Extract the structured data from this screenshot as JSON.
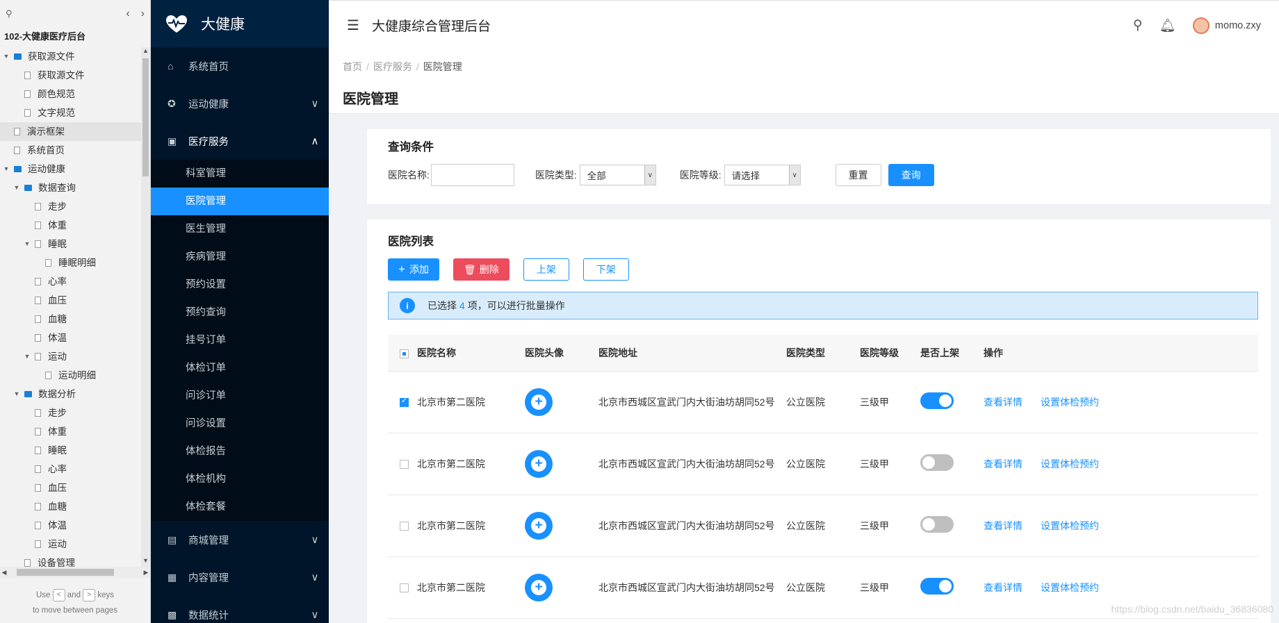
{
  "axure": {
    "project_title": "102-大健康医疗后台",
    "tree": [
      {
        "label": "获取源文件",
        "level": 0,
        "type": "folder",
        "twisty": "▼"
      },
      {
        "label": "获取源文件",
        "level": 1,
        "type": "page"
      },
      {
        "label": "颜色规范",
        "level": 1,
        "type": "page"
      },
      {
        "label": "文字规范",
        "level": 1,
        "type": "page"
      },
      {
        "label": "演示框架",
        "level": 0,
        "type": "page",
        "selected": true
      },
      {
        "label": "系统首页",
        "level": 0,
        "type": "page"
      },
      {
        "label": "运动健康",
        "level": 0,
        "type": "folder",
        "twisty": "▼"
      },
      {
        "label": "数据查询",
        "level": 1,
        "type": "folder",
        "twisty": "▼"
      },
      {
        "label": "走步",
        "level": 2,
        "type": "page"
      },
      {
        "label": "体重",
        "level": 2,
        "type": "page"
      },
      {
        "label": "睡眠",
        "level": 2,
        "type": "page",
        "twisty": "▼"
      },
      {
        "label": "睡眠明细",
        "level": 3,
        "type": "page"
      },
      {
        "label": "心率",
        "level": 2,
        "type": "page"
      },
      {
        "label": "血压",
        "level": 2,
        "type": "page"
      },
      {
        "label": "血糖",
        "level": 2,
        "type": "page"
      },
      {
        "label": "体温",
        "level": 2,
        "type": "page"
      },
      {
        "label": "运动",
        "level": 2,
        "type": "page",
        "twisty": "▼"
      },
      {
        "label": "运动明细",
        "level": 3,
        "type": "page"
      },
      {
        "label": "数据分析",
        "level": 1,
        "type": "folder",
        "twisty": "▼"
      },
      {
        "label": "走步",
        "level": 2,
        "type": "page"
      },
      {
        "label": "体重",
        "level": 2,
        "type": "page"
      },
      {
        "label": "睡眠",
        "level": 2,
        "type": "page"
      },
      {
        "label": "心率",
        "level": 2,
        "type": "page"
      },
      {
        "label": "血压",
        "level": 2,
        "type": "page"
      },
      {
        "label": "血糖",
        "level": 2,
        "type": "page"
      },
      {
        "label": "体温",
        "level": 2,
        "type": "page"
      },
      {
        "label": "运动",
        "level": 2,
        "type": "page"
      },
      {
        "label": "设备管理",
        "level": 1,
        "type": "page"
      }
    ],
    "hint": {
      "use": "Use",
      "and": "and",
      "keys": "keys",
      "line2": "to move between pages",
      "prev_key": "<",
      "next_key": ">"
    }
  },
  "app": {
    "logo_text": "大健康",
    "header_title": "大健康综合管理后台",
    "username": "momo.zxy"
  },
  "menu": {
    "home": "系统首页",
    "sports": "运动健康",
    "medical": "医疗服务",
    "medical_subs": [
      "科室管理",
      "医院管理",
      "医生管理",
      "疾病管理",
      "预约设置",
      "预约查询",
      "挂号订单",
      "体检订单",
      "问诊订单",
      "问诊设置",
      "体检报告",
      "体检机构",
      "体检套餐"
    ],
    "active_sub": "医院管理",
    "mall": "商城管理",
    "content": "内容管理",
    "stats": "数据统计"
  },
  "breadcrumb": [
    "首页",
    "医疗服务",
    "医院管理"
  ],
  "page_title": "医院管理",
  "query": {
    "title": "查询条件",
    "name_label": "医院名称:",
    "name_value": "",
    "type_label": "医院类型:",
    "type_value": "全部",
    "level_label": "医院等级:",
    "level_value": "请选择",
    "reset": "重置",
    "search": "查询"
  },
  "list": {
    "title": "医院列表",
    "add": "添加",
    "delete": "删除",
    "up": "上架",
    "down": "下架",
    "alert_pre": "已选择",
    "alert_count": "4",
    "alert_post": "项，可以进行批量操作",
    "columns": [
      "医院名称",
      "医院头像",
      "医院地址",
      "医院类型",
      "医院等级",
      "是否上架",
      "操作"
    ],
    "rows": [
      {
        "checked": true,
        "name": "北京市第二医院",
        "address": "北京市西城区宣武门内大街油坊胡同52号",
        "type": "公立医院",
        "level": "三级甲",
        "on_shelf": true,
        "action1": "查看详情",
        "action2": "设置体检预约"
      },
      {
        "checked": false,
        "name": "北京市第二医院",
        "address": "北京市西城区宣武门内大街油坊胡同52号",
        "type": "公立医院",
        "level": "三级甲",
        "on_shelf": false,
        "action1": "查看详情",
        "action2": "设置体检预约"
      },
      {
        "checked": false,
        "name": "北京市第二医院",
        "address": "北京市西城区宣武门内大街油坊胡同52号",
        "type": "公立医院",
        "level": "三级甲",
        "on_shelf": false,
        "action1": "查看详情",
        "action2": "设置体检预约"
      },
      {
        "checked": false,
        "name": "北京市第二医院",
        "address": "北京市西城区宣武门内大街油坊胡同52号",
        "type": "公立医院",
        "level": "三级甲",
        "on_shelf": true,
        "action1": "查看详情",
        "action2": "设置体检预约"
      }
    ]
  },
  "watermark": "https://blog.csdn.net/baidu_36836080",
  "colors": {
    "primary": "#1890ff",
    "danger": "#ed4c5c",
    "sidebar": "#001529"
  }
}
